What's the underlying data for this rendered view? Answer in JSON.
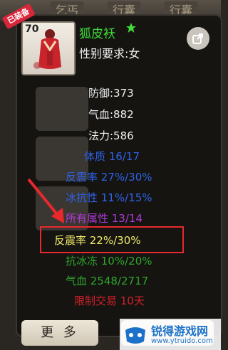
{
  "background": {
    "tabs": [
      "乞丐",
      "行囊",
      "行囊"
    ]
  },
  "item": {
    "equipped_badge": "已装备",
    "level": "70",
    "name": "狐皮袄",
    "star_icon": "star-icon",
    "gender_requirement": "性别要求:女"
  },
  "stats": {
    "defense": "防御:373",
    "hp": "气血:882",
    "mana": "法力:586",
    "constitution": "体质 16/17",
    "reflect_damage_1": "反震率 27%/30%",
    "ice_resist": "冰抗性 11%/15%",
    "all_attributes": "所有属性 13/14",
    "reflect_damage_2": "反震率 22%/30%",
    "anti_freeze": "抗冰冻 10%/20%",
    "hp_bonus": "气血 2548/2717",
    "trade_limit": "限制交易 10天"
  },
  "buttons": {
    "more_label": "更 多"
  },
  "watermark": {
    "name": "锐得游戏网",
    "url": "www.ytruido.com"
  },
  "colors": {
    "name_green": "#3fdc3a",
    "blue": "#2f62e6",
    "purple": "#b03ad6",
    "yellow": "#f1ea6b",
    "green": "#2fa52c",
    "red": "#d3202a",
    "highlight_red": "#e8282c"
  }
}
